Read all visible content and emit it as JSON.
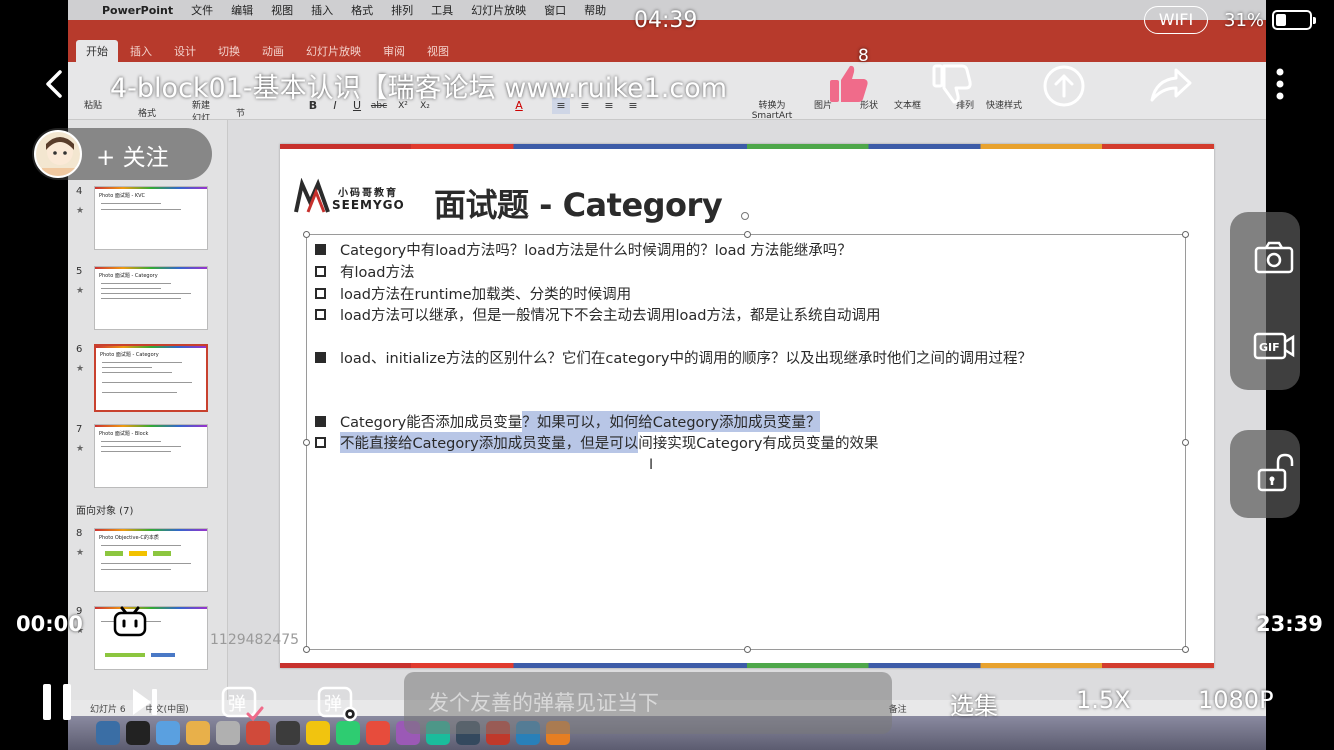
{
  "status_bar": {
    "clock": "04:39",
    "wifi": "WIFI",
    "battery_percent": "31%",
    "battery_level": 0.31
  },
  "video": {
    "title": "4-block01-基本认识【瑞客论坛 www.ruike1.com",
    "like_count": "8",
    "follow_label": "+ 关注",
    "time_current": "00:00",
    "time_total": "23:39",
    "uploader_id": "1129482475",
    "danmaku_placeholder": "发个友善的弹幕见证当下",
    "episodes_label": "选集",
    "speed_label": "1.5X",
    "quality_label": "1080P"
  },
  "mac": {
    "menubar": [
      "PowerPoint",
      "文件",
      "编辑",
      "视图",
      "插入",
      "格式",
      "排列",
      "工具",
      "幻灯片放映",
      "窗口",
      "帮助"
    ]
  },
  "ppt": {
    "tabs": [
      "开始",
      "插入",
      "设计",
      "切换",
      "动画",
      "幻灯片放映",
      "审阅",
      "视图"
    ],
    "active_tab": 0,
    "ribbon_labels": [
      "粘贴",
      "格式",
      "新建幻灯片",
      "节",
      "转换为SmartArt",
      "图片",
      "形状",
      "文本框",
      "排列",
      "快速样式"
    ],
    "section_label": "面向对象 (7)",
    "thumbnails": [
      {
        "num": "4",
        "title": "Photo 面试题 - KVC"
      },
      {
        "num": "5",
        "title": "Photo 面试题 - Category"
      },
      {
        "num": "6",
        "title": "Photo 面试题 - Category"
      },
      {
        "num": "7",
        "title": "Photo 面试题 - Block"
      },
      {
        "num": "8",
        "title": "Photo Objective-C的本质"
      },
      {
        "num": "9",
        "title": ""
      }
    ],
    "statusbar": [
      "幻灯片 6",
      "中文(中国)",
      "备注"
    ]
  },
  "slide": {
    "logo_text_cn": "小码哥教育",
    "logo_text_en": "SEEMYGO",
    "title": "面试题 - Category",
    "bullets": [
      {
        "type": "fill",
        "text": "Category中有load方法吗？load方法是什么时候调用的？load 方法能继承吗？"
      },
      {
        "type": "hollow",
        "text": "有load方法"
      },
      {
        "type": "hollow",
        "text": "load方法在runtime加载类、分类的时候调用"
      },
      {
        "type": "hollow",
        "text": "load方法可以继承，但是一般情况下不会主动去调用load方法，都是让系统自动调用"
      },
      {
        "type": "fill",
        "text": "load、initialize方法的区别什么？它们在category中的调用的顺序？以及出现继承时他们之间的调用过程？"
      },
      {
        "type": "fill",
        "text_plain": "Category能否添加成员变量",
        "text_hl": "？如果可以，如何给Category添加成员变量？"
      },
      {
        "type": "hollow",
        "text_hl": "不能直接给Category添加成员变量，但是可以",
        "text_plain": "间接实现Category有成员变量的效果"
      }
    ]
  },
  "icons": {
    "back": "chevron-left-icon",
    "like": "thumbs-up-icon",
    "dislike": "thumbs-down-icon",
    "coin": "coin-icon",
    "share": "share-icon",
    "more": "more-vertical-icon",
    "screenshot": "camera-icon",
    "gif": "gif-icon",
    "lock": "unlock-icon",
    "play": "pause-icon",
    "next": "skip-next-icon",
    "danmaku": "danmaku-icon",
    "danmaku_settings": "danmaku-settings-icon"
  },
  "colors": {
    "ppt_accent": "#b73a2c",
    "like_active": "#f06b8a",
    "highlight": "#b8c6e6"
  }
}
